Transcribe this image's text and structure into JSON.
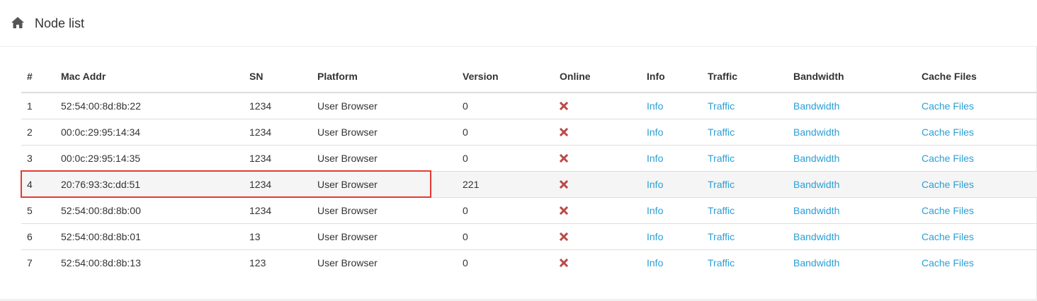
{
  "header": {
    "title": "Node list",
    "icon": "home-icon"
  },
  "table": {
    "columns": [
      "#",
      "Mac Addr",
      "SN",
      "Platform",
      "Version",
      "Online",
      "Info",
      "Traffic",
      "Bandwidth",
      "Cache Files"
    ],
    "rows": [
      {
        "num": "1",
        "mac": "52:54:00:8d:8b:22",
        "sn": "1234",
        "platform": "User Browser",
        "version": "0",
        "online": "offline",
        "info": "Info",
        "traffic": "Traffic",
        "bandwidth": "Bandwidth",
        "cache": "Cache Files"
      },
      {
        "num": "2",
        "mac": "00:0c:29:95:14:34",
        "sn": "1234",
        "platform": "User Browser",
        "version": "0",
        "online": "offline",
        "info": "Info",
        "traffic": "Traffic",
        "bandwidth": "Bandwidth",
        "cache": "Cache Files"
      },
      {
        "num": "3",
        "mac": "00:0c:29:95:14:35",
        "sn": "1234",
        "platform": "User Browser",
        "version": "0",
        "online": "offline",
        "info": "Info",
        "traffic": "Traffic",
        "bandwidth": "Bandwidth",
        "cache": "Cache Files"
      },
      {
        "num": "4",
        "mac": "20:76:93:3c:dd:51",
        "sn": "1234",
        "platform": "User Browser",
        "version": "221",
        "online": "offline",
        "info": "Info",
        "traffic": "Traffic",
        "bandwidth": "Bandwidth",
        "cache": "Cache Files"
      },
      {
        "num": "5",
        "mac": "52:54:00:8d:8b:00",
        "sn": "1234",
        "platform": "User Browser",
        "version": "0",
        "online": "offline",
        "info": "Info",
        "traffic": "Traffic",
        "bandwidth": "Bandwidth",
        "cache": "Cache Files"
      },
      {
        "num": "6",
        "mac": "52:54:00:8d:8b:01",
        "sn": "13",
        "platform": "User Browser",
        "version": "0",
        "online": "offline",
        "info": "Info",
        "traffic": "Traffic",
        "bandwidth": "Bandwidth",
        "cache": "Cache Files"
      },
      {
        "num": "7",
        "mac": "52:54:00:8d:8b:13",
        "sn": "123",
        "platform": "User Browser",
        "version": "0",
        "online": "offline",
        "info": "Info",
        "traffic": "Traffic",
        "bandwidth": "Bandwidth",
        "cache": "Cache Files"
      }
    ],
    "highlighted_row": "4"
  },
  "colors": {
    "link": "#2a9fd6",
    "offline_icon": "#b94a48",
    "highlight_border": "#e53935",
    "row_hover": "#f5f5f5"
  }
}
